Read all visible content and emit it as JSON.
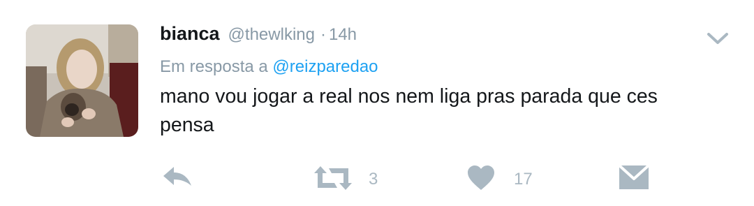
{
  "tweet": {
    "author_name": "bianca",
    "handle": "@thewlking",
    "separator": "·",
    "time": "14h",
    "reply_prefix": "Em resposta a",
    "reply_to": "@reizparedao",
    "text": "mano vou jogar a real nos nem liga pras parada que ces pensa",
    "retweet_count": "3",
    "like_count": "17"
  },
  "icons": {
    "menu": "chevron-down-icon",
    "reply": "reply-arrow-icon",
    "retweet": "retweet-icon",
    "like": "heart-icon",
    "message": "envelope-icon"
  },
  "colors": {
    "text_primary": "#14171a",
    "text_secondary": "#8899a6",
    "link": "#1da1f2",
    "action_icon": "#aab8c2",
    "background": "#ffffff"
  }
}
